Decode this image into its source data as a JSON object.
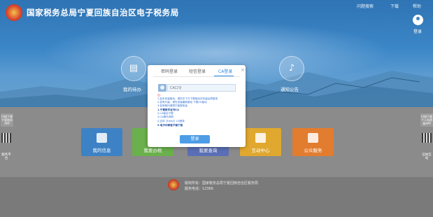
{
  "header": {
    "title": "国家税务总局宁夏回族自治区电子税务局",
    "links": [
      "问题搜索",
      "下载",
      "帮助"
    ],
    "login_label": "登录"
  },
  "nav_circles": [
    {
      "label": "我的待办",
      "icon": "todo-icon"
    },
    {
      "label": "通知公告",
      "icon": "bell-icon"
    }
  ],
  "tiles": [
    {
      "label": "我的信息",
      "color": "#3d82c4",
      "icon": "user-icon"
    },
    {
      "label": "我要办税",
      "color": "#6ab04c",
      "icon": "tax-icon"
    },
    {
      "label": "我要查询",
      "color": "#5a6fb6",
      "icon": "search-icon"
    },
    {
      "label": "互动中心",
      "color": "#e0a82e",
      "icon": "chat-icon"
    },
    {
      "label": "公众服务",
      "color": "#e27c2f",
      "icon": "service-icon"
    }
  ],
  "side_left": {
    "text": "扫描下载宁夏税务APP",
    "button": "服务平台"
  },
  "side_right": {
    "text": "扫描下载个人所得税APP",
    "button": "征纳互动"
  },
  "modal": {
    "tabs": [
      "密码登录",
      "短信登录",
      "CA登录"
    ],
    "active_tab": "CA登录",
    "close": "×",
    "ca_placeholder": "CA口令",
    "notes": [
      {
        "text": "注：",
        "style": "red"
      },
      {
        "text": "1.如未安装驱动，请先在下方下载驱动并安装后再登录",
        "style": "blue"
      },
      {
        "text": "2.如有升级，请先安装最新驱动 下载CA驱动",
        "style": "blue"
      },
      {
        "text": "3.如有疑问请拨打客服电话",
        "style": "blue"
      },
      {
        "text": "1.宁夏数字证书CA",
        "style": "bold"
      },
      {
        "text": "2.CA驱动下载",
        "style": "blue"
      },
      {
        "text": "3.CA操作说明",
        "style": "blue"
      },
      {
        "text": "4.支持【Ukey】CA登录",
        "style": "blue"
      },
      {
        "text": "5.电子印章客户端下载",
        "style": "bold"
      }
    ],
    "login_button": "登录"
  },
  "footer": {
    "line1": "版权所有：国家税务总局宁夏回族自治区税务局",
    "line2": "服务电话：12366"
  }
}
